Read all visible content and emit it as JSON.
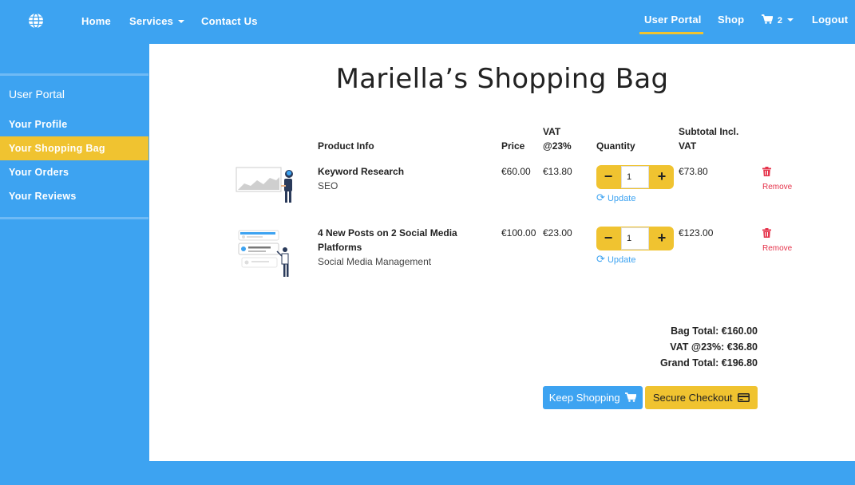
{
  "nav": {
    "home": "Home",
    "services": "Services",
    "contact": "Contact Us",
    "user_portal": "User Portal",
    "shop": "Shop",
    "cart_count": "2",
    "logout": "Logout"
  },
  "sidebar": {
    "heading": "User Portal",
    "items": [
      {
        "label": "Your Profile"
      },
      {
        "label": "Your Shopping Bag"
      },
      {
        "label": "Your Orders"
      },
      {
        "label": "Your Reviews"
      }
    ]
  },
  "page": {
    "title": "Mariella’s Shopping Bag"
  },
  "table": {
    "headers": {
      "product": "Product Info",
      "price": "Price",
      "vat_line1": "VAT",
      "vat_line2": "@23%",
      "quantity": "Quantity",
      "subtotal_line1": "Subtotal Incl.",
      "subtotal_line2": "VAT"
    },
    "rows": [
      {
        "name": "Keyword Research",
        "category": "SEO",
        "price": "€60.00",
        "vat": "€13.80",
        "qty": "1",
        "subtotal": "€73.80",
        "update": "Update",
        "remove": "Remove"
      },
      {
        "name_line1": "4 New Posts on 2 Social Media",
        "name_line2": "Platforms",
        "category": "Social Media Management",
        "price": "€100.00",
        "vat": "€23.00",
        "qty": "1",
        "subtotal": "€123.00",
        "update": "Update",
        "remove": "Remove"
      }
    ]
  },
  "totals": {
    "bag": "Bag Total: €160.00",
    "vat": "VAT @23%: €36.80",
    "grand": "Grand Total: €196.80"
  },
  "buttons": {
    "keep_shopping": "Keep Shopping",
    "checkout": "Secure Checkout"
  },
  "colors": {
    "primary": "#3da3f1",
    "accent": "#f0c330",
    "danger": "#e5334b"
  },
  "icons": [
    "globe-icon",
    "cart-icon",
    "minus-icon",
    "plus-icon",
    "refresh-icon",
    "trash-icon",
    "credit-card-icon"
  ]
}
